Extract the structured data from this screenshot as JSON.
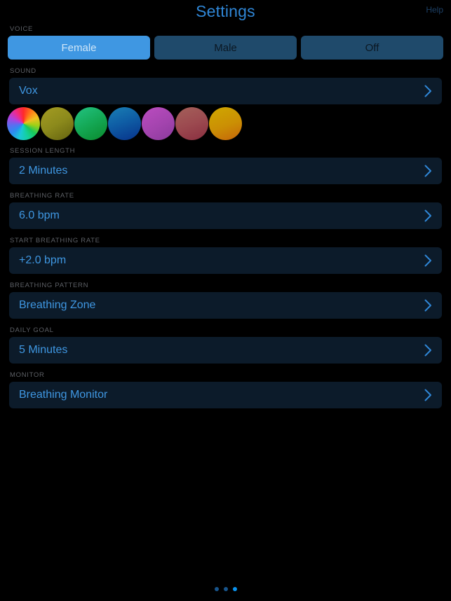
{
  "header": {
    "title": "Settings",
    "help_label": "Help"
  },
  "voice": {
    "label": "VOICE",
    "options": [
      {
        "label": "Female",
        "active": true
      },
      {
        "label": "Male",
        "active": false
      },
      {
        "label": "Off",
        "active": false
      }
    ]
  },
  "sound": {
    "label": "SOUND",
    "value": "Vox",
    "swatches": [
      {
        "name": "rainbow",
        "colors": [
          "#ff2a2a",
          "#f0c020",
          "#18c85a",
          "#1ac8d8",
          "#2a6ef0",
          "#b040e0"
        ]
      },
      {
        "name": "olive",
        "colors": [
          "#9a9420",
          "#6d6a14"
        ]
      },
      {
        "name": "green",
        "colors": [
          "#1fb978",
          "#0f8a32"
        ]
      },
      {
        "name": "blue",
        "colors": [
          "#1572a8",
          "#0b3d8e"
        ]
      },
      {
        "name": "magenta",
        "colors": [
          "#b046b8",
          "#8e3a9e"
        ]
      },
      {
        "name": "brick",
        "colors": [
          "#9e5a55",
          "#8e3240"
        ]
      },
      {
        "name": "gold",
        "colors": [
          "#c8a200",
          "#c86a08"
        ]
      }
    ]
  },
  "rows": [
    {
      "label": "SESSION LENGTH",
      "value": "2 Minutes",
      "name": "session-length"
    },
    {
      "label": "BREATHING RATE",
      "value": "6.0 bpm",
      "name": "breathing-rate"
    },
    {
      "label": "START BREATHING RATE",
      "value": "+2.0 bpm",
      "name": "start-breathing-rate"
    },
    {
      "label": "BREATHING PATTERN",
      "value": "Breathing Zone",
      "name": "breathing-pattern"
    },
    {
      "label": "DAILY GOAL",
      "value": "5 Minutes",
      "name": "daily-goal"
    },
    {
      "label": "MONITOR",
      "value": "Breathing Monitor",
      "name": "monitor"
    }
  ],
  "pagination": {
    "count": 3,
    "active_index": 2
  },
  "colors": {
    "background": "#000000",
    "accent": "#3f97e2",
    "row_background": "#0c1b2a",
    "segment_inactive": "#1f4a6b",
    "label_text": "#5d6066",
    "help_text": "#1d4066",
    "dot_active": "#0a93ef",
    "dot_inactive": "#18558c"
  }
}
